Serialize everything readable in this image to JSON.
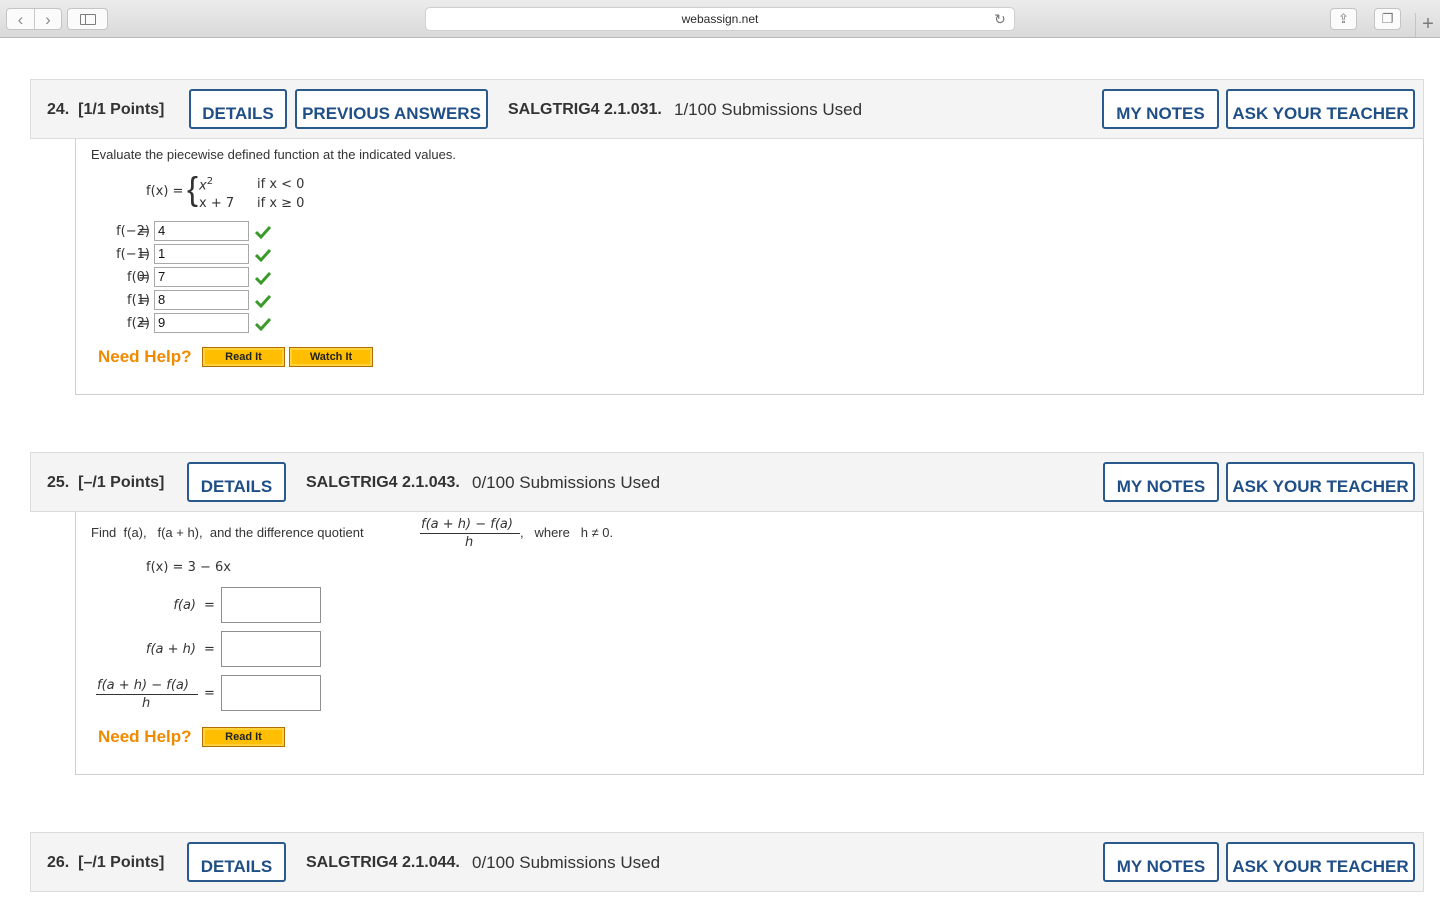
{
  "browser": {
    "url": "webassign.net",
    "nav_back_icon": "chevron-left-icon",
    "nav_forward_icon": "chevron-right-icon",
    "back_glyph": "‹",
    "forward_glyph": "›",
    "reload_glyph": "↻",
    "share_glyph": "⇪",
    "tabs_glyph": "❐",
    "newtab_glyph": "+"
  },
  "questions": [
    {
      "number": "24.",
      "points": "[1/1 Points]",
      "details_label": "DETAILS",
      "previous_answers_label": "PREVIOUS ANSWERS",
      "code": "SALGTRIG4 2.1.031.",
      "submissions": "1/100 Submissions Used",
      "my_notes_label": "MY NOTES",
      "ask_teacher_label": "ASK YOUR TEACHER",
      "prompt": "Evaluate the piecewise defined function at the indicated values.",
      "function_lhs": "f(x) =",
      "piece1_expr": "x",
      "piece1_sup": "2",
      "piece1_cond": "if x < 0",
      "piece2_expr": "x + 7",
      "piece2_cond": "if x ≥ 0",
      "answers": [
        {
          "label": "f(−2)",
          "eq": "=",
          "value": "4",
          "correct": true
        },
        {
          "label": "f(−1)",
          "eq": "=",
          "value": "1",
          "correct": true
        },
        {
          "label": "f(0)",
          "eq": "=",
          "value": "7",
          "correct": true
        },
        {
          "label": "f(1)",
          "eq": "=",
          "value": "8",
          "correct": true
        },
        {
          "label": "f(2)",
          "eq": "=",
          "value": "9",
          "correct": true
        }
      ],
      "need_help": "Need Help?",
      "read_it": "Read It",
      "watch_it": "Watch It"
    },
    {
      "number": "25.",
      "points": "[–/1 Points]",
      "details_label": "DETAILS",
      "code": "SALGTRIG4 2.1.043.",
      "submissions": "0/100 Submissions Used",
      "my_notes_label": "MY NOTES",
      "ask_teacher_label": "ASK YOUR TEACHER",
      "prompt_start": "Find  f(a),   f(a + h),  and the difference quotient",
      "dq_numerator": "f(a + h) − f(a)",
      "dq_denominator": "h",
      "prompt_end": ",   where   h ≠ 0.",
      "function_def": "f(x) = 3 − 6x",
      "fields": [
        {
          "label": "f(a)",
          "eq": "=",
          "value": ""
        },
        {
          "label": "f(a + h)",
          "eq": "=",
          "value": ""
        }
      ],
      "dq_field_numerator": "f(a + h) − f(a)",
      "dq_field_denominator": "h",
      "dq_field_eq": "=",
      "dq_field_value": "",
      "need_help": "Need Help?",
      "read_it": "Read It"
    },
    {
      "number": "26.",
      "points": "[–/1 Points]",
      "details_label": "DETAILS",
      "code": "SALGTRIG4 2.1.044.",
      "submissions": "0/100 Submissions Used",
      "my_notes_label": "MY NOTES",
      "ask_teacher_label": "ASK YOUR TEACHER"
    }
  ],
  "colors": {
    "accent_blue": "#1f4f86",
    "need_help_orange": "#f08a00",
    "help_button_yellow": "#ffbf00",
    "check_green": "#3a9a2a"
  }
}
